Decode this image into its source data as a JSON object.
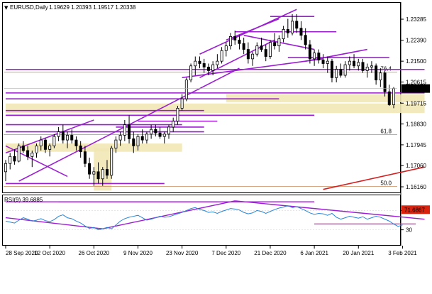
{
  "header": {
    "symbol_label": "EURUSD,Daily",
    "ohlc_label": "1.19629 1.20393 1.19517 1.20338"
  },
  "rsi_label": "RSI(9) 39.6885",
  "colors": {
    "background": "#ffffff",
    "candle": "#000000",
    "trendline": "#9b1fd1",
    "support_zone": "#f1e7b5",
    "fib_line": "#c98a5a",
    "red_line": "#d42020",
    "rsi_line": "#2a86d6",
    "rsi_high_badge": "#d9230f",
    "price_badge": "#000000",
    "grid": "#d8d8d8"
  },
  "chart_data": {
    "type": "candlestick",
    "title": "EURUSD,Daily",
    "y_axis": {
      "ticks": [
        "1.23285",
        "1.22390",
        "1.21500",
        "1.20615",
        "1.19715",
        "1.18830",
        "1.17945",
        "1.17060",
        "1.16160"
      ],
      "range": [
        1.1595,
        1.2395
      ]
    },
    "current_price": "1.20338",
    "x_axis": {
      "labels": [
        "28 Sep 2020",
        "12 Oct 2020",
        "26 Oct 2020",
        "9 Nov 2020",
        "23 Nov 2020",
        "7 Dec 2020",
        "21 Dec 2020",
        "6 Jan 2021",
        "20 Jan 2021",
        "3 Feb 2021"
      ],
      "label_bar_index": [
        0,
        10,
        20,
        30,
        40,
        50,
        60,
        70,
        80,
        90
      ]
    },
    "fib_labels": [
      {
        "text": "76.4",
        "price": 1.2103
      },
      {
        "text": "61.8",
        "price": 1.1838
      },
      {
        "text": "50.0",
        "price": 1.1618
      }
    ],
    "candles": [
      [
        1.168,
        1.173,
        1.164,
        1.1715
      ],
      [
        1.1715,
        1.176,
        1.169,
        1.1745
      ],
      [
        1.1745,
        1.1775,
        1.171,
        1.1725
      ],
      [
        1.1725,
        1.18,
        1.172,
        1.179
      ],
      [
        1.179,
        1.181,
        1.176,
        1.177
      ],
      [
        1.177,
        1.179,
        1.173,
        1.1745
      ],
      [
        1.1745,
        1.177,
        1.17,
        1.176
      ],
      [
        1.176,
        1.18,
        1.174,
        1.179
      ],
      [
        1.179,
        1.183,
        1.177,
        1.1815
      ],
      [
        1.1815,
        1.1825,
        1.176,
        1.1775
      ],
      [
        1.1775,
        1.18,
        1.1745,
        1.179
      ],
      [
        1.179,
        1.184,
        1.178,
        1.183
      ],
      [
        1.183,
        1.187,
        1.181,
        1.185
      ],
      [
        1.185,
        1.188,
        1.18,
        1.1815
      ],
      [
        1.1815,
        1.185,
        1.178,
        1.1835
      ],
      [
        1.1835,
        1.186,
        1.18,
        1.1815
      ],
      [
        1.1815,
        1.183,
        1.177,
        1.179
      ],
      [
        1.179,
        1.181,
        1.174,
        1.1765
      ],
      [
        1.1765,
        1.179,
        1.17,
        1.1715
      ],
      [
        1.1715,
        1.174,
        1.165,
        1.167
      ],
      [
        1.167,
        1.17,
        1.162,
        1.168
      ],
      [
        1.168,
        1.172,
        1.163,
        1.165
      ],
      [
        1.165,
        1.17,
        1.162,
        1.169
      ],
      [
        1.169,
        1.173,
        1.165,
        1.1665
      ],
      [
        1.1665,
        1.179,
        1.165,
        1.178
      ],
      [
        1.178,
        1.183,
        1.176,
        1.1815
      ],
      [
        1.1815,
        1.185,
        1.179,
        1.1835
      ],
      [
        1.1835,
        1.19,
        1.181,
        1.188
      ],
      [
        1.188,
        1.192,
        1.18,
        1.182
      ],
      [
        1.182,
        1.185,
        1.176,
        1.179
      ],
      [
        1.179,
        1.184,
        1.177,
        1.183
      ],
      [
        1.183,
        1.186,
        1.18,
        1.1815
      ],
      [
        1.1815,
        1.185,
        1.18,
        1.184
      ],
      [
        1.184,
        1.188,
        1.182,
        1.186
      ],
      [
        1.186,
        1.188,
        1.183,
        1.1845
      ],
      [
        1.1845,
        1.187,
        1.182,
        1.183
      ],
      [
        1.183,
        1.185,
        1.18,
        1.184
      ],
      [
        1.184,
        1.188,
        1.182,
        1.187
      ],
      [
        1.187,
        1.191,
        1.185,
        1.1895
      ],
      [
        1.1895,
        1.196,
        1.188,
        1.195
      ],
      [
        1.195,
        1.201,
        1.194,
        1.199
      ],
      [
        1.199,
        1.208,
        1.198,
        1.207
      ],
      [
        1.207,
        1.214,
        1.206,
        1.213
      ],
      [
        1.213,
        1.217,
        1.209,
        1.215
      ],
      [
        1.215,
        1.217,
        1.212,
        1.214
      ],
      [
        1.214,
        1.216,
        1.21,
        1.2125
      ],
      [
        1.2125,
        1.214,
        1.209,
        1.211
      ],
      [
        1.211,
        1.215,
        1.209,
        1.2135
      ],
      [
        1.2135,
        1.218,
        1.212,
        1.215
      ],
      [
        1.215,
        1.221,
        1.214,
        1.2195
      ],
      [
        1.2195,
        1.223,
        1.217,
        1.2215
      ],
      [
        1.2215,
        1.227,
        1.22,
        1.2255
      ],
      [
        1.2255,
        1.228,
        1.222,
        1.224
      ],
      [
        1.224,
        1.226,
        1.22,
        1.2225
      ],
      [
        1.2225,
        1.225,
        1.218,
        1.22
      ],
      [
        1.22,
        1.223,
        1.214,
        1.216
      ],
      [
        1.216,
        1.219,
        1.213,
        1.218
      ],
      [
        1.218,
        1.223,
        1.217,
        1.2215
      ],
      [
        1.2215,
        1.225,
        1.219,
        1.22
      ],
      [
        1.22,
        1.222,
        1.215,
        1.217
      ],
      [
        1.217,
        1.224,
        1.216,
        1.223
      ],
      [
        1.223,
        1.227,
        1.22,
        1.2215
      ],
      [
        1.2215,
        1.226,
        1.219,
        1.2245
      ],
      [
        1.2245,
        1.23,
        1.223,
        1.2285
      ],
      [
        1.2285,
        1.233,
        1.225,
        1.227
      ],
      [
        1.227,
        1.235,
        1.226,
        1.232
      ],
      [
        1.232,
        1.235,
        1.227,
        1.229
      ],
      [
        1.229,
        1.232,
        1.224,
        1.226
      ],
      [
        1.226,
        1.229,
        1.22,
        1.222
      ],
      [
        1.222,
        1.224,
        1.214,
        1.216
      ],
      [
        1.216,
        1.22,
        1.213,
        1.2185
      ],
      [
        1.2185,
        1.22,
        1.214,
        1.2155
      ],
      [
        1.2155,
        1.218,
        1.212,
        1.214
      ],
      [
        1.214,
        1.217,
        1.21,
        1.215
      ],
      [
        1.215,
        1.216,
        1.206,
        1.208
      ],
      [
        1.208,
        1.213,
        1.206,
        1.2115
      ],
      [
        1.2115,
        1.214,
        1.208,
        1.209
      ],
      [
        1.209,
        1.215,
        1.208,
        1.2135
      ],
      [
        1.2135,
        1.217,
        1.211,
        1.215
      ],
      [
        1.215,
        1.218,
        1.212,
        1.213
      ],
      [
        1.213,
        1.216,
        1.211,
        1.2145
      ],
      [
        1.2145,
        1.216,
        1.21,
        1.211
      ],
      [
        1.211,
        1.214,
        1.208,
        1.2125
      ],
      [
        1.2125,
        1.215,
        1.21,
        1.213
      ],
      [
        1.213,
        1.214,
        1.205,
        1.207
      ],
      [
        1.207,
        1.212,
        1.204,
        1.21
      ],
      [
        1.21,
        1.211,
        1.2,
        1.202
      ],
      [
        1.202,
        1.205,
        1.196,
        1.1965
      ],
      [
        1.1965,
        1.204,
        1.195,
        1.2034
      ]
    ],
    "trendlines": [
      [
        [
          0,
          1.176
        ],
        [
          20,
          1.19
        ]
      ],
      [
        [
          0,
          1.179
        ],
        [
          14,
          1.166
        ]
      ],
      [
        [
          3,
          1.164
        ],
        [
          53,
          1.212
        ]
      ],
      [
        [
          44,
          1.208
        ],
        [
          61,
          1.224
        ]
      ],
      [
        [
          44,
          1.218
        ],
        [
          66,
          1.237
        ]
      ],
      [
        [
          50,
          1.224
        ],
        [
          62,
          1.233
        ]
      ],
      [
        [
          54,
          1.226
        ],
        [
          70,
          1.22
        ]
      ],
      [
        [
          52,
          1.2275
        ],
        [
          75,
          1.2275
        ]
      ],
      [
        [
          60,
          1.234
        ],
        [
          70,
          1.234
        ]
      ],
      [
        [
          64,
          1.2165
        ],
        [
          87,
          1.2165
        ]
      ],
      [
        [
          68,
          1.215
        ],
        [
          82,
          1.22
        ]
      ],
      [
        [
          40,
          1.208
        ],
        [
          72,
          1.216
        ]
      ],
      [
        [
          0,
          1.2115
        ],
        [
          95,
          1.2115
        ]
      ],
      [
        [
          0,
          1.2015
        ],
        [
          95,
          1.2015
        ]
      ],
      [
        [
          0,
          1.199
        ],
        [
          62,
          1.199
        ]
      ],
      [
        [
          0,
          1.194
        ],
        [
          45,
          1.194
        ]
      ],
      [
        [
          0,
          1.185
        ],
        [
          45,
          1.185
        ]
      ],
      [
        [
          0,
          1.188
        ],
        [
          40,
          1.188
        ]
      ],
      [
        [
          25,
          1.187
        ],
        [
          45,
          1.187
        ]
      ],
      [
        [
          0,
          1.163
        ],
        [
          36,
          1.163
        ]
      ],
      [
        [
          30,
          1.1895
        ],
        [
          48,
          1.1895
        ]
      ],
      [
        [
          0,
          1.192
        ],
        [
          70,
          1.192
        ]
      ]
    ],
    "zones": [
      [
        0,
        95,
        1.193,
        1.197
      ],
      [
        50,
        95,
        1.1975,
        1.201
      ],
      [
        0,
        40,
        1.1765,
        1.18
      ],
      [
        20,
        24,
        1.16,
        1.178
      ]
    ],
    "red_line": [
      [
        72,
        1.1605
      ],
      [
        95,
        1.17
      ]
    ],
    "rsi": {
      "label": "RSI(9) 39.6885",
      "ticks": [
        "70",
        "30"
      ],
      "high_value": "71.6867",
      "range": [
        0,
        100
      ],
      "values": [
        48,
        46,
        44,
        50,
        55,
        52,
        48,
        50,
        53,
        49,
        47,
        51,
        58,
        61,
        55,
        53,
        48,
        44,
        38,
        33,
        35,
        30,
        32,
        35,
        32,
        40,
        48,
        53,
        56,
        58,
        60,
        55,
        50,
        52,
        55,
        58,
        56,
        57,
        60,
        63,
        66,
        70,
        74,
        76,
        72,
        70,
        66,
        67,
        64,
        68,
        71,
        74,
        73,
        71,
        66,
        63,
        65,
        70,
        68,
        64,
        68,
        72,
        75,
        77,
        80,
        76,
        78,
        74,
        70,
        65,
        62,
        64,
        63,
        60,
        64,
        56,
        52,
        55,
        58,
        56,
        54,
        57,
        52,
        55,
        58,
        56,
        52,
        48,
        42,
        37,
        40
      ],
      "lines": [
        [
          [
            0,
            55
          ],
          [
            22,
            32
          ]
        ],
        [
          [
            22,
            32
          ],
          [
            52,
            90
          ]
        ],
        [
          [
            52,
            90
          ],
          [
            95,
            52
          ]
        ],
        [
          [
            12,
            88
          ],
          [
            48,
            88
          ]
        ],
        [
          [
            0,
            88
          ],
          [
            70,
            88
          ]
        ],
        [
          [
            70,
            42
          ],
          [
            93,
            42
          ]
        ]
      ]
    }
  }
}
